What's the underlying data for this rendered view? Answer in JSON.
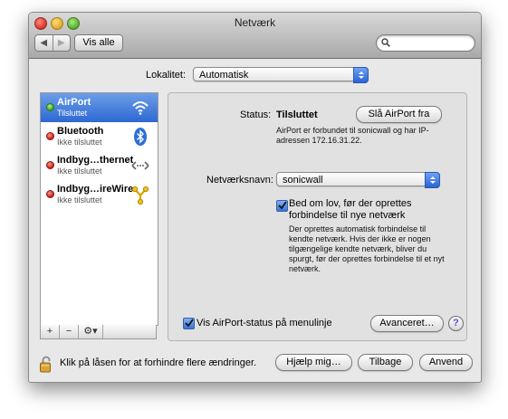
{
  "window": {
    "title": "Netværk"
  },
  "toolbar": {
    "show_all_label": "Vis alle",
    "search": {
      "value": "",
      "placeholder": ""
    }
  },
  "location": {
    "label": "Lokalitet:",
    "value": "Automatisk"
  },
  "services": [
    {
      "name": "AirPort",
      "status": "Tilsluttet",
      "status_color": "green",
      "icon": "wifi-icon",
      "selected": true
    },
    {
      "name": "Bluetooth",
      "status": "Ikke tilsluttet",
      "status_color": "red",
      "icon": "bluetooth-icon",
      "selected": false
    },
    {
      "name": "Indbyg…thernet",
      "status": "Ikke tilsluttet",
      "status_color": "red",
      "icon": "ethernet-icon",
      "selected": false
    },
    {
      "name": "Indbyg…ireWire",
      "status": "Ikke tilsluttet",
      "status_color": "red",
      "icon": "firewire-icon",
      "selected": false
    }
  ],
  "sidebar_controls": {
    "add": "+",
    "remove": "−",
    "gear": "⚙▾"
  },
  "detail": {
    "status_label": "Status:",
    "status_value": "Tilsluttet",
    "toggle_button": "Slå AirPort fra",
    "status_desc": "AirPort er forbundet til sonicwall og har IP-adressen 172.16.31.22.",
    "network_name_label": "Netværksnavn:",
    "network_name_value": "sonicwall",
    "ask_checkbox_label": "Bed om lov, før der oprettes forbindelse til nye netværk",
    "ask_checked": true,
    "ask_desc": "Der oprettes automatisk forbindelse til kendte netværk. Hvis der ikke er nogen tilgængelige kendte netværk, bliver du spurgt, før der oprettes forbindelse til et nyt netværk.",
    "menubar_checkbox_label": "Vis AirPort-status på menulinje",
    "menubar_checked": true,
    "advanced_button": "Avanceret…",
    "help_button": "?"
  },
  "footer": {
    "lock_text": "Klik på låsen for at forhindre flere ændringer.",
    "help_me_button": "Hjælp mig…",
    "revert_button": "Tilbage",
    "apply_button": "Anvend"
  },
  "colors": {
    "selection": "#2e68d2",
    "accent": "#3c74d6",
    "connected": "#34a312",
    "disconnected": "#c51d10"
  }
}
